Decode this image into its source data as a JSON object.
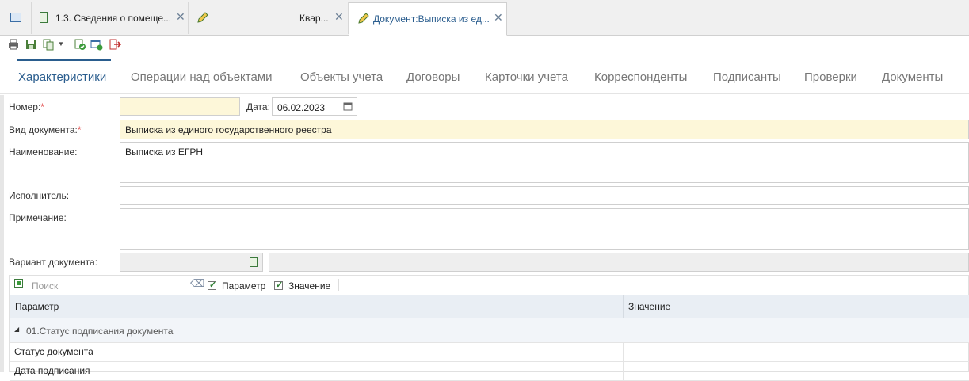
{
  "tabs": [
    {
      "label": "",
      "icon": "form-icon"
    },
    {
      "label": "1.3. Сведения о помеще...",
      "icon": "document-icon",
      "close": "✕"
    },
    {
      "label": "Квар...",
      "icon": "pencil-icon",
      "close": "✕"
    },
    {
      "label": "Документ:Выписка из ед...",
      "icon": "pencil-icon",
      "close": "✕",
      "active": true
    }
  ],
  "toolbar": [
    "print-icon",
    "save-icon",
    "copy-icon",
    "dropdown-arrow-icon",
    "refresh-check-icon",
    "window-check-icon",
    "exit-icon"
  ],
  "nav": {
    "items": [
      "Характеристики",
      "Операции над объектами",
      "Объекты учета",
      "Договоры",
      "Карточки учета",
      "Корреспонденты",
      "Подписанты",
      "Проверки",
      "Документы"
    ],
    "active": "Характеристики"
  },
  "form": {
    "number_label": "Номер:",
    "required_mark": "*",
    "number_value": "",
    "date_label": "Дата:",
    "date_value": "06.02.2023",
    "doctype_label": "Вид документа:",
    "doctype_value": "Выписка из единого государственного реестра",
    "name_label": "Наименование:",
    "name_value": "Выписка из ЕГРН",
    "executor_label": "Исполнитель:",
    "executor_value": "",
    "note_label": "Примечание:",
    "note_value": "",
    "variant_label": "Вариант документа:",
    "variant_value": ""
  },
  "grid": {
    "search_placeholder": "Поиск",
    "filter_param": "Параметр",
    "filter_value": "Значение",
    "columns": [
      "Параметр",
      "Значение"
    ],
    "group": "01.Статус подписания документа",
    "rows": [
      {
        "param": "Статус документа",
        "value": ""
      },
      {
        "param": "Дата подписания",
        "value": ""
      }
    ]
  },
  "colors": {
    "accent": "#2a5d8e",
    "required": "#e04040",
    "yellow_field": "#fdf7d9",
    "header": "#e9eef4"
  }
}
